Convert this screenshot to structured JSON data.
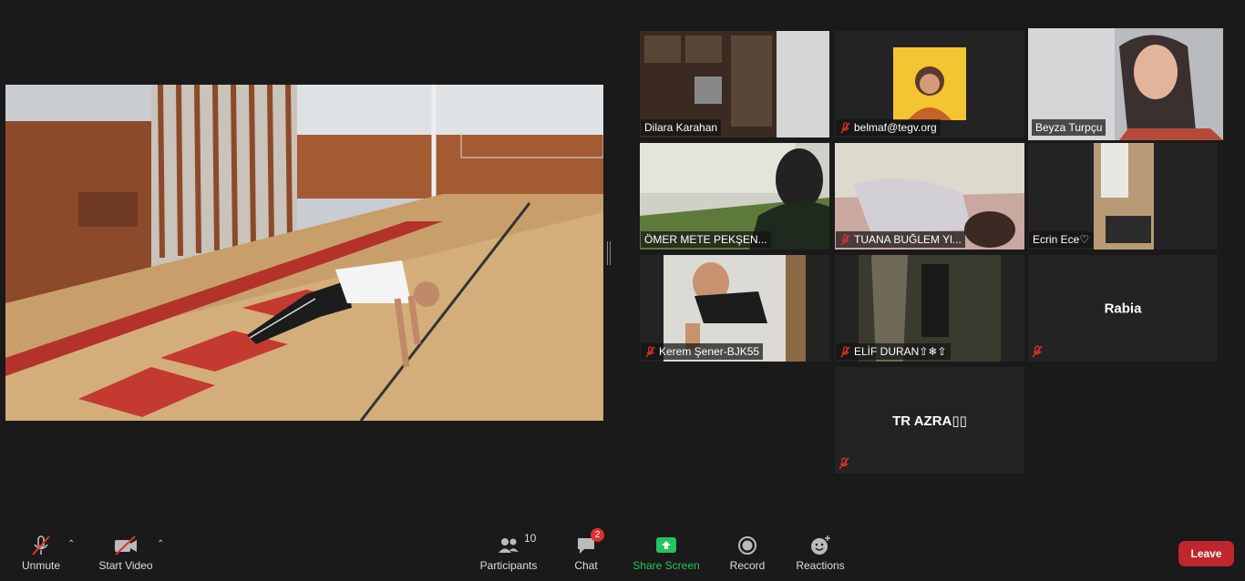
{
  "speaker": {
    "label": ""
  },
  "participants": [
    {
      "name": "Dilara Karahan",
      "muted": false
    },
    {
      "name": "belmaf@tegv.org",
      "muted": true
    },
    {
      "name": "Beyza Turpçu",
      "muted": false,
      "active": true
    },
    {
      "name": "ÖMER METE PEKŞEN...",
      "muted": false
    },
    {
      "name": "TUANA BUĞLEM Yl...",
      "muted": true
    },
    {
      "name": "Ecrin Ece♡",
      "muted": false
    },
    {
      "name": "Kerem Şener-BJK55",
      "muted": true
    },
    {
      "name": "ELİF DURAN⇧❄⇧",
      "muted": true
    },
    {
      "name": "Rabia",
      "muted": true,
      "video": false
    },
    {
      "name": "TR AZRA▯▯",
      "muted": true,
      "video": false
    }
  ],
  "toolbar": {
    "unmute": "Unmute",
    "start_video": "Start Video",
    "participants": "Participants",
    "participants_count": "10",
    "chat": "Chat",
    "chat_badge": "2",
    "share_screen": "Share Screen",
    "record": "Record",
    "reactions": "Reactions",
    "leave": "Leave"
  },
  "colors": {
    "background": "#1a1a1a",
    "active_speaker_outline": "#b9e25e",
    "share_green": "#22c55e",
    "leave_red": "#c0262d",
    "mute_red": "#e0302e"
  }
}
